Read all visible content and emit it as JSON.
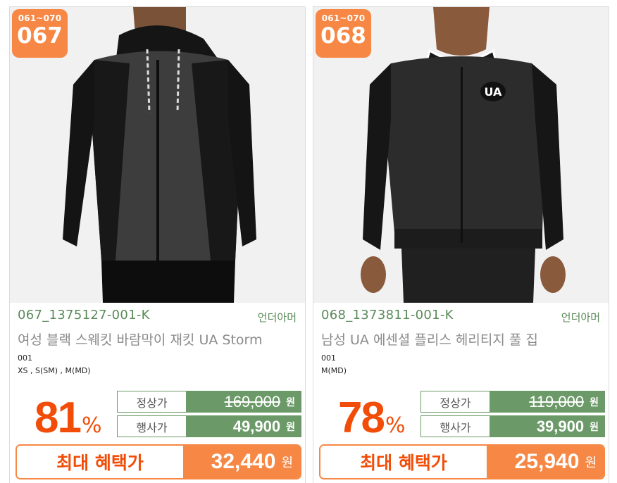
{
  "products": [
    {
      "range": "061~070",
      "number": "067",
      "code": "067_1375127-001-K",
      "brand": "언더아머",
      "name": "여성 블랙 스웨킷 바람막이 재킷 UA Storm",
      "color": "001",
      "sizes": "XS , S(SM) , M(MD)",
      "discount": "81",
      "discount_sign": "%",
      "regular_label": "정상가",
      "regular_price": "169,000",
      "event_label": "행사가",
      "event_price": "49,900",
      "best_label": "최대 혜택가",
      "best_price": "32,440",
      "currency": "원",
      "photo_alt": "woman in black zip hoodie"
    },
    {
      "range": "061~070",
      "number": "068",
      "code": "068_1373811-001-K",
      "brand": "언더아머",
      "name": "남성 UA 에센셜 플리스 헤리티지 풀 집",
      "color": "001",
      "sizes": "M(MD)",
      "discount": "78",
      "discount_sign": "%",
      "regular_label": "정상가",
      "regular_price": "119,000",
      "event_label": "행사가",
      "event_price": "39,900",
      "best_label": "최대 혜택가",
      "best_price": "25,940",
      "currency": "원",
      "photo_alt": "man in black fleece full zip jacket"
    }
  ],
  "colors": {
    "badge": "#f68744",
    "discount": "#f14d08",
    "price_green": "#6b9a68",
    "code_green": "#5a8a5a"
  }
}
